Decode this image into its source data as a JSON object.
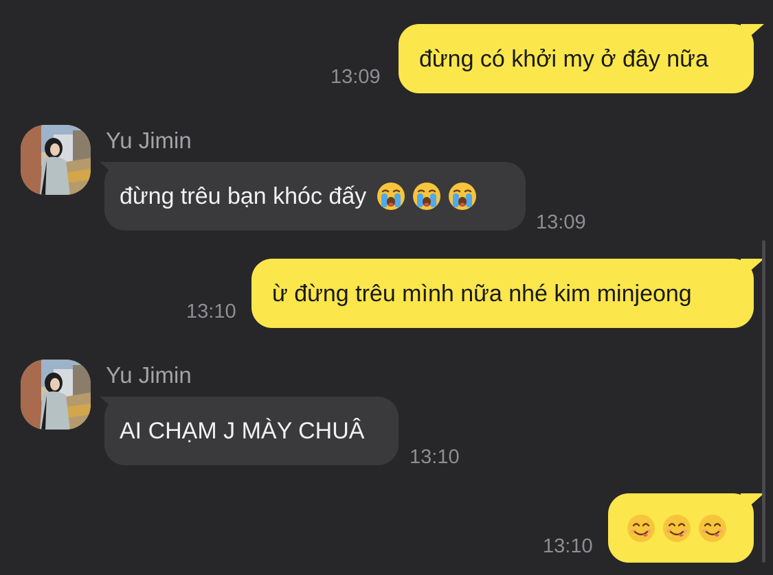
{
  "conversation": {
    "messages": [
      {
        "direction": "outgoing",
        "text": "đừng có khởi my ở đây nữa",
        "time": "13:09"
      },
      {
        "direction": "incoming",
        "sender": "Yu Jimin",
        "text": "đừng trêu bạn khóc đấy",
        "emojis": [
          "loudly-crying-face",
          "loudly-crying-face",
          "loudly-crying-face"
        ],
        "time": "13:09"
      },
      {
        "direction": "outgoing",
        "text": "ừ đừng trêu mình nữa nhé kim minjeong",
        "time": "13:10"
      },
      {
        "direction": "incoming",
        "sender": "Yu Jimin",
        "text": "AI CHẠM J MÀY CHUÂ",
        "time": "13:10"
      },
      {
        "direction": "outgoing",
        "text": "",
        "emojis": [
          "face-savoring-food",
          "face-savoring-food",
          "face-savoring-food"
        ],
        "time": "13:10"
      }
    ]
  },
  "colors": {
    "background": "#272729",
    "outgoing_bubble": "#fbe64b",
    "incoming_bubble": "#3a3a3c",
    "timestamp": "#8e8e93",
    "sender_name": "#a4a4a8"
  }
}
